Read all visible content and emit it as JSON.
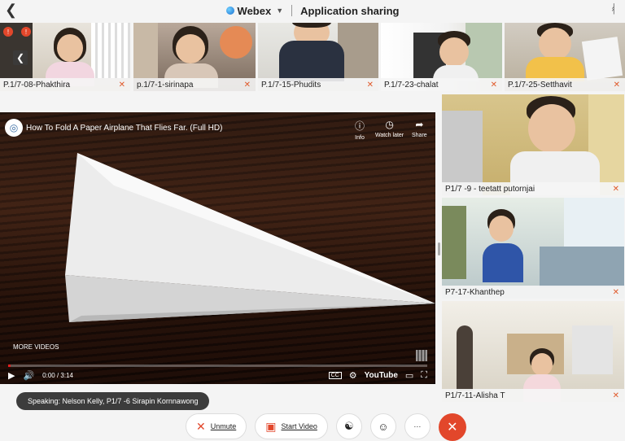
{
  "topbar": {
    "back_icon": "chevron-left-icon",
    "brand": "Webex",
    "title": "Application sharing",
    "bluetooth_icon": "bluetooth-icon"
  },
  "strip": {
    "participants": [
      {
        "name": "P.1/7-08-Phakthira"
      },
      {
        "name": "p.1/7-1-sirinapa"
      },
      {
        "name": "P.1/7-15-Phudits"
      },
      {
        "name": "P.1/7-23-chalat"
      },
      {
        "name": "P.1/7-25-Setthavit"
      }
    ],
    "badges": [
      "!",
      "!"
    ]
  },
  "video": {
    "title": "How To Fold A Paper Airplane That Flies Far. (Full HD)",
    "info_label": "Info",
    "watch_later_label": "Watch later",
    "share_label": "Share",
    "more_videos": "MORE VIDEOS",
    "time": "0:00 / 3:14",
    "youtube": "YouTube",
    "cc": "CC",
    "progress_fraction": 0.0
  },
  "side": {
    "participants": [
      {
        "name": "P1/7 -9 - teetatt putornjai"
      },
      {
        "name": "P7-17-Khanthep"
      },
      {
        "name": "P1/7-11-Alisha T"
      }
    ]
  },
  "speaking": "Speaking: Nelson Kelly, P1/7 -6 Sirapin Kornnawong",
  "toolbar": {
    "unmute": "Unmute",
    "start_video": "Start Video",
    "more": "···"
  },
  "colors": {
    "accent_red": "#e2472b",
    "brand_blue": "#1b6fd1"
  }
}
